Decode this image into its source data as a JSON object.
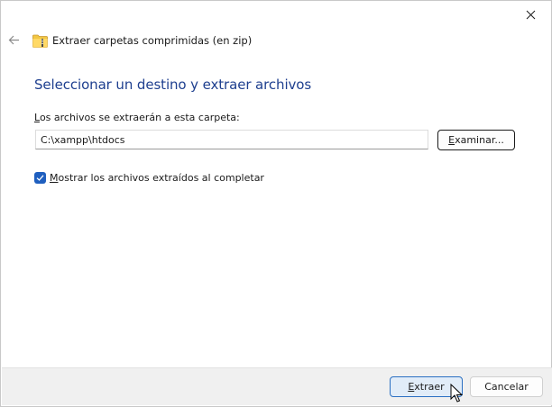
{
  "window": {
    "title": "Extraer carpetas comprimidas (en zip)",
    "close_icon": "close-icon",
    "back_icon": "back-arrow-icon",
    "title_icon": "zip-folder-icon"
  },
  "main": {
    "heading": "Seleccionar un destino y extraer archivos",
    "path_label_accel": "L",
    "path_label_rest": "os archivos se extraerán a esta carpeta:",
    "path_value": "C:\\xampp\\htdocs",
    "browse_accel": "E",
    "browse_rest": "xaminar...",
    "show_files_accel": "M",
    "show_files_rest": "ostrar los archivos extraídos al completar",
    "show_files_checked": true
  },
  "footer": {
    "extract_accel": "E",
    "extract_rest": "xtraer",
    "cancel_label": "Cancelar"
  },
  "colors": {
    "heading": "#1e3f8f",
    "accent": "#1f5fbf",
    "footer_bg": "#f0f0f0"
  }
}
